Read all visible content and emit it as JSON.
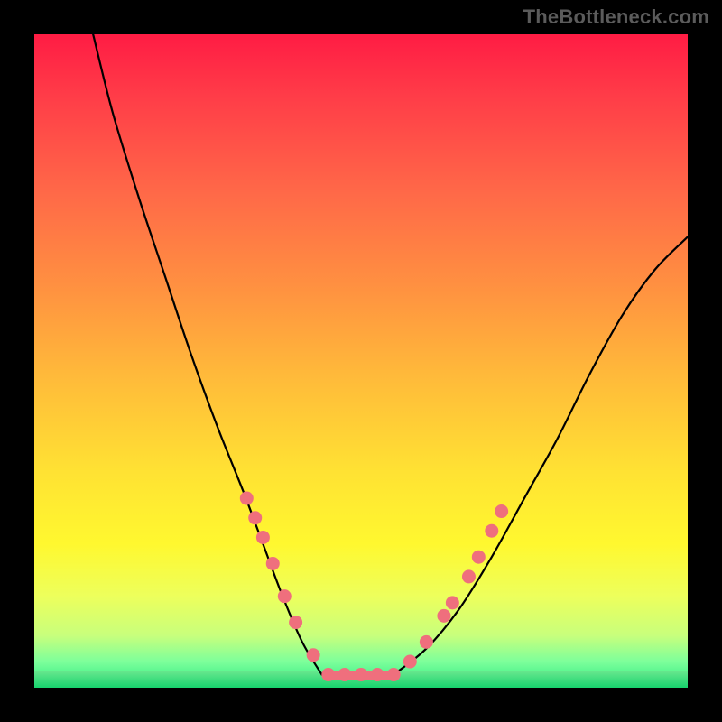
{
  "attribution": "TheBottleneck.com",
  "colors": {
    "point": "#ef6f7d",
    "curve": "#000000"
  },
  "chart_data": {
    "type": "line",
    "title": "",
    "xlabel": "",
    "ylabel": "",
    "xlim": [
      0,
      100
    ],
    "ylim": [
      0,
      100
    ],
    "curve_left": {
      "comment": "steep descending limb; y = bottleneck % (100=top red, 0=bottom green)",
      "x": [
        9,
        12,
        16,
        20,
        24,
        28,
        32,
        35,
        38,
        41,
        44
      ],
      "y": [
        100,
        88,
        75,
        63,
        51,
        40,
        30,
        22,
        14,
        7,
        2
      ]
    },
    "curve_right": {
      "comment": "shallower ascending limb",
      "x": [
        55,
        60,
        65,
        70,
        75,
        80,
        85,
        90,
        95,
        100
      ],
      "y": [
        2,
        6,
        12,
        20,
        29,
        38,
        48,
        57,
        64,
        69
      ]
    },
    "flat_segment": {
      "x_start": 44,
      "x_end": 55,
      "y": 2
    },
    "points_left": [
      {
        "x": 32.5,
        "y": 29
      },
      {
        "x": 33.8,
        "y": 26
      },
      {
        "x": 35.0,
        "y": 23
      },
      {
        "x": 36.5,
        "y": 19
      },
      {
        "x": 38.3,
        "y": 14
      },
      {
        "x": 40.0,
        "y": 10
      },
      {
        "x": 42.7,
        "y": 5
      }
    ],
    "points_right": [
      {
        "x": 57.5,
        "y": 4
      },
      {
        "x": 60.0,
        "y": 7
      },
      {
        "x": 62.7,
        "y": 11
      },
      {
        "x": 64.0,
        "y": 13
      },
      {
        "x": 66.5,
        "y": 17
      },
      {
        "x": 68.0,
        "y": 20
      },
      {
        "x": 70.0,
        "y": 24
      },
      {
        "x": 71.5,
        "y": 27
      }
    ],
    "points_bottom": [
      {
        "x": 45,
        "y": 2
      },
      {
        "x": 47.5,
        "y": 2
      },
      {
        "x": 50,
        "y": 2
      },
      {
        "x": 52.5,
        "y": 2
      },
      {
        "x": 55,
        "y": 2
      }
    ]
  }
}
